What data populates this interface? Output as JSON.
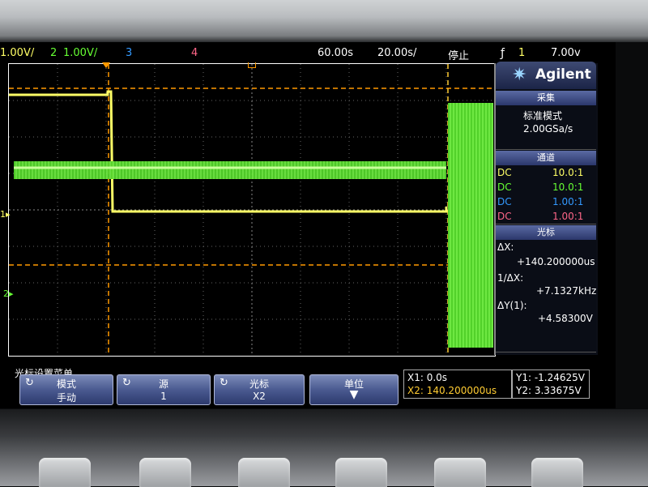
{
  "status_bar": {
    "ch1_label": "1",
    "ch1_scale": "1.00V/",
    "ch2_label": "2",
    "ch2_scale": "1.00V/",
    "ch3_label": "3",
    "ch4_label": "4",
    "time_offset": "60.00s",
    "time_scale": "20.00s/",
    "run_state": "停止",
    "trigger_icon": "trigger-edge-icon",
    "trigger_source": "1",
    "trigger_level": "7.00v"
  },
  "panel": {
    "brand": "Agilent",
    "acquire_header": "采集",
    "acquire_mode": "标准模式",
    "sample_rate": "2.00GSa/s",
    "channels_header": "通道",
    "channels": [
      {
        "coupling": "DC",
        "probe": "10.0:1",
        "color": "#ffff66"
      },
      {
        "coupling": "DC",
        "probe": "10.0:1",
        "color": "#66ff33"
      },
      {
        "coupling": "DC",
        "probe": "1.00:1",
        "color": "#3399ff"
      },
      {
        "coupling": "DC",
        "probe": "1.00:1",
        "color": "#ff6688"
      }
    ],
    "cursor_header": "光标",
    "delta_x_label": "ΔX:",
    "delta_x_value": "+140.200000us",
    "inv_delta_x_label": "1/ΔX:",
    "inv_delta_x_value": "+7.1327kHz",
    "delta_y_label": "ΔY(1):",
    "delta_y_value": "+4.58300V"
  },
  "softkeys": {
    "menu_title": "光标设置菜单",
    "mode_label": "模式",
    "mode_value": "手动",
    "source_label": "源",
    "source_value": "1",
    "cursor_label": "光标",
    "cursor_value": "X2",
    "units_label": "单位"
  },
  "cursor_readout": {
    "x1": "X1: 0.0s",
    "x2": "X2: 140.200000us",
    "y1": "Y1: -1.24625V",
    "y2": "Y2: 3.33675V"
  },
  "colors": {
    "ch1": "#ffff66",
    "ch2": "#66ff33",
    "ch3": "#3399ff",
    "ch4": "#ff6688",
    "cursor": "#ff9900"
  }
}
